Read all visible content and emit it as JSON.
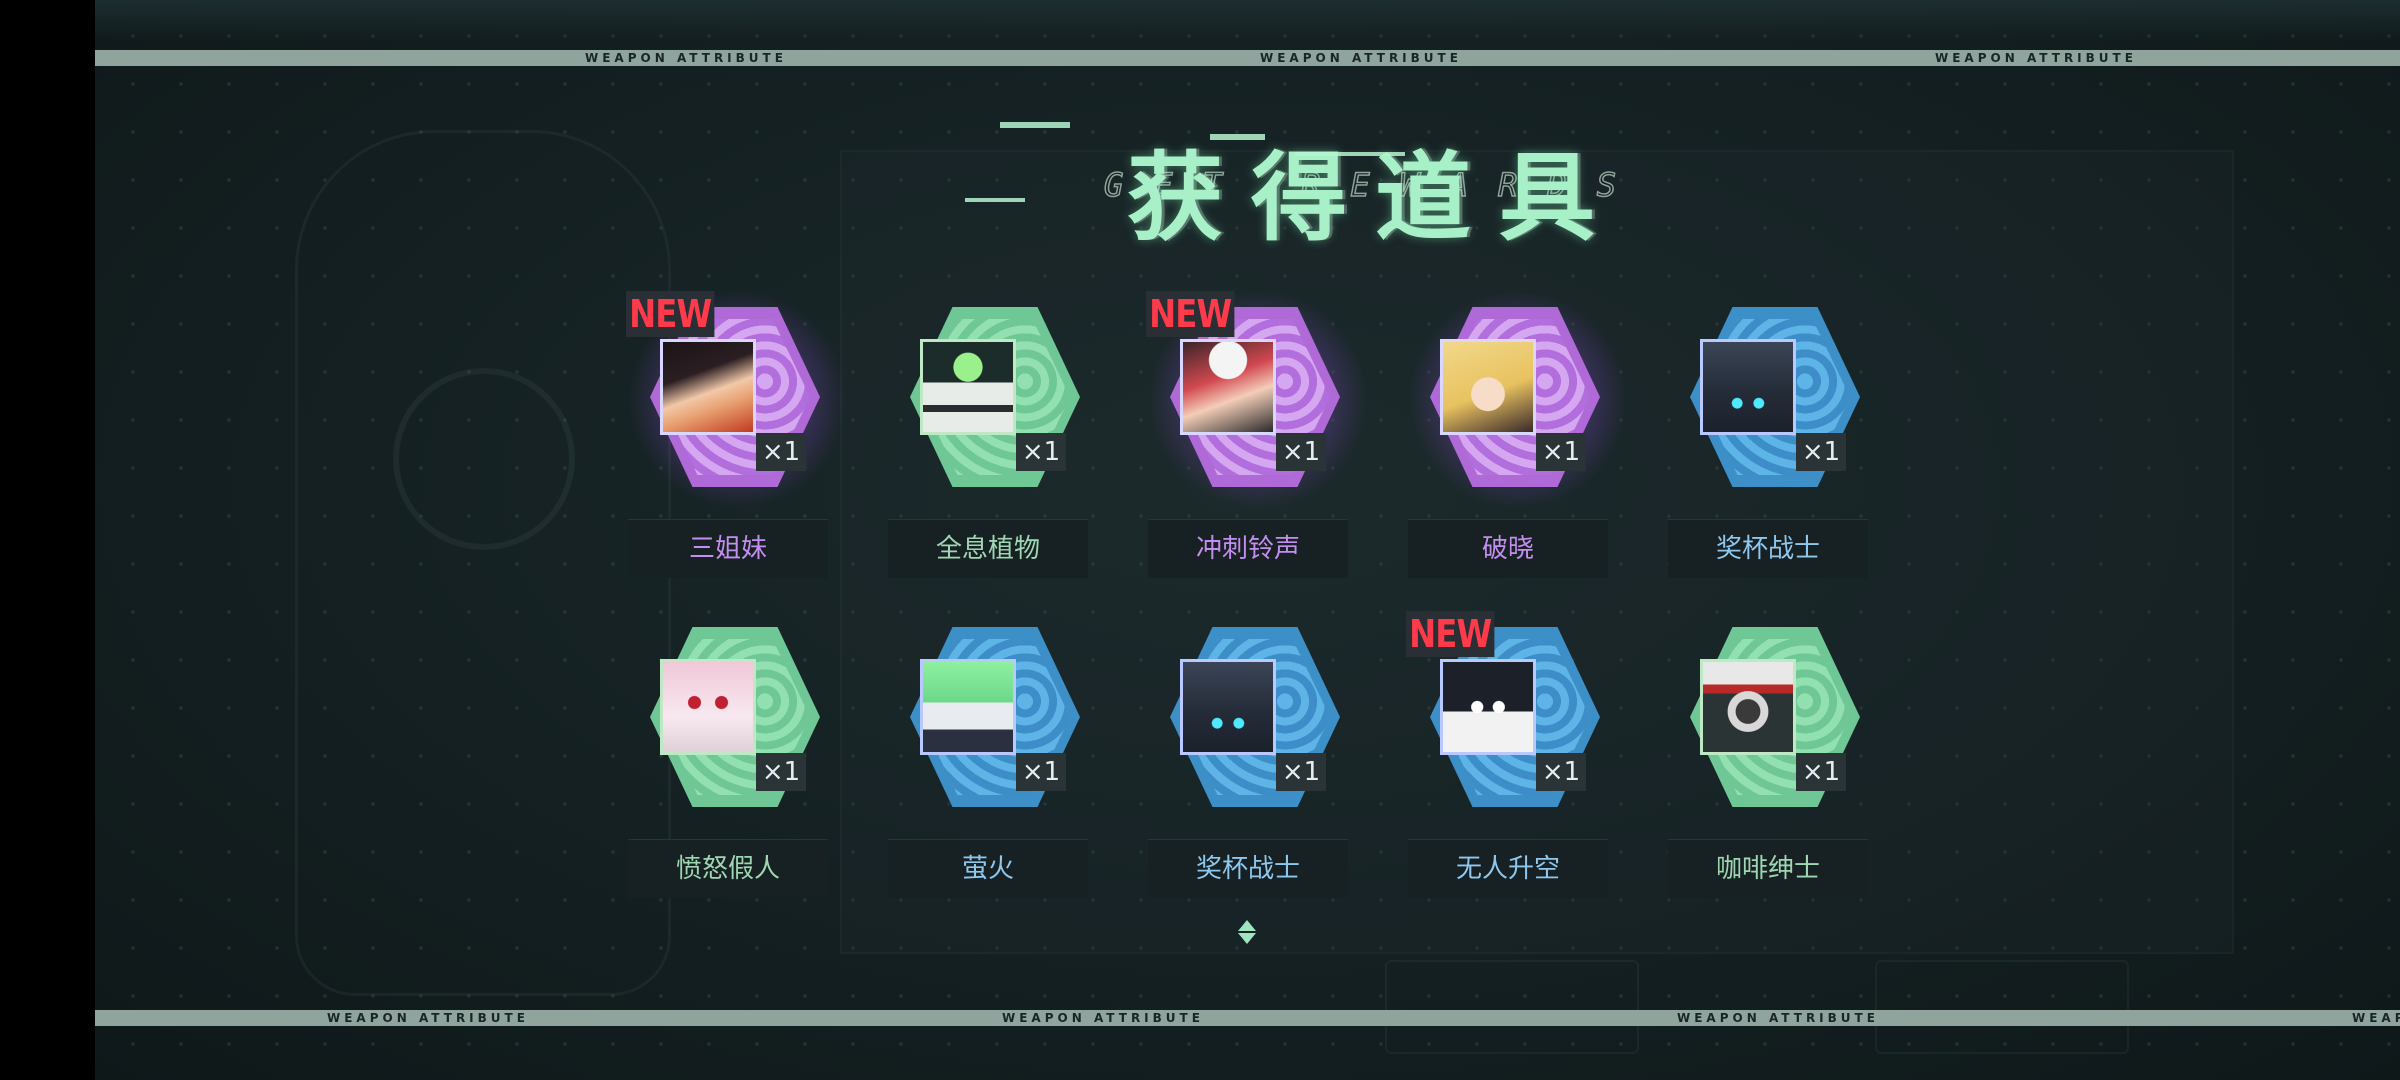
{
  "header": {
    "title_cn": "获得道具",
    "title_en": "GET REWARDS",
    "band_label": "WEAPON ATTRIBUTE"
  },
  "rewards": [
    {
      "name": "三姐妹",
      "qty": "×1",
      "rarity": "purple",
      "is_new": true,
      "new_label": "NEW",
      "icon": "anime-girl-dark-hair-portrait"
    },
    {
      "name": "全息植物",
      "qty": "×1",
      "rarity": "green",
      "is_new": false,
      "new_label": "",
      "icon": "hologram-plant-pot-icon"
    },
    {
      "name": "冲刺铃声",
      "qty": "×1",
      "rarity": "purple",
      "is_new": true,
      "new_label": "NEW",
      "icon": "anime-girl-red-hair-cap-portrait"
    },
    {
      "name": "破晓",
      "qty": "×1",
      "rarity": "purple",
      "is_new": false,
      "new_label": "",
      "icon": "anime-girl-blonde-portrait"
    },
    {
      "name": "奖杯战士",
      "qty": "×1",
      "rarity": "blue",
      "is_new": false,
      "new_label": "",
      "icon": "dark-robot-helmet-icon"
    },
    {
      "name": "愤怒假人",
      "qty": "×1",
      "rarity": "green",
      "is_new": false,
      "new_label": "",
      "icon": "angry-pink-dummy-icon"
    },
    {
      "name": "萤火",
      "qty": "×1",
      "rarity": "blue",
      "is_new": false,
      "new_label": "",
      "icon": "green-dome-robot-icon"
    },
    {
      "name": "奖杯战士",
      "qty": "×1",
      "rarity": "blue",
      "is_new": false,
      "new_label": "",
      "icon": "dark-robot-helmet-icon"
    },
    {
      "name": "无人升空",
      "qty": "×1",
      "rarity": "blue",
      "is_new": true,
      "new_label": "NEW",
      "icon": "penguin-robot-icon"
    },
    {
      "name": "咖啡绅士",
      "qty": "×1",
      "rarity": "green",
      "is_new": false,
      "new_label": "",
      "icon": "coffee-gentleman-icon"
    }
  ],
  "scroll_hint_icon": "double-chevron-icon",
  "colors": {
    "purple": "#b06ad8",
    "green": "#6fc796",
    "blue": "#3d8fc8",
    "new_red": "#ff3a4a",
    "title_green": "#a8f0c8"
  }
}
